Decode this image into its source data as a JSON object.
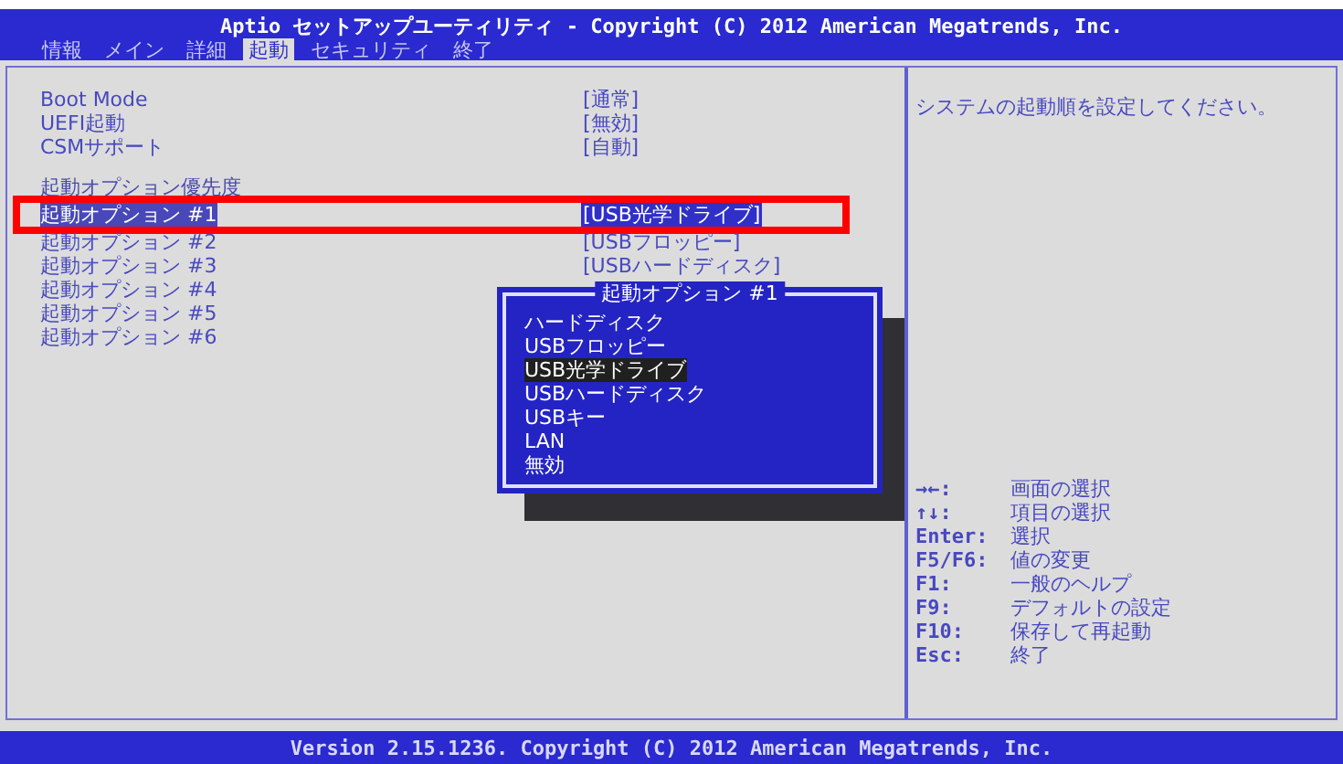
{
  "title": "Aptio セットアップユーティリティ - Copyright (C) 2012 American Megatrends, Inc.",
  "tabs": [
    {
      "label": "情報",
      "selected": false
    },
    {
      "label": "メイン",
      "selected": false
    },
    {
      "label": "詳細",
      "selected": false
    },
    {
      "label": "起動",
      "selected": true
    },
    {
      "label": "セキュリティ",
      "selected": false
    },
    {
      "label": "終了",
      "selected": false
    }
  ],
  "settings": [
    {
      "kind": "setting",
      "label": "Boot Mode",
      "value": "[通常]",
      "selected": false
    },
    {
      "kind": "setting",
      "label": "UEFI起動",
      "value": "[無効]",
      "selected": false
    },
    {
      "kind": "setting",
      "label": "CSMサポート",
      "value": "[自動]",
      "selected": false
    },
    {
      "kind": "spacer"
    },
    {
      "kind": "heading",
      "label": "起動オプション優先度"
    },
    {
      "kind": "setting",
      "label": "起動オプション #1",
      "value": "[USB光学ドライブ]",
      "selected": true,
      "highlighted": true
    },
    {
      "kind": "setting",
      "label": "起動オプション #2",
      "value": "[USBフロッピー]",
      "selected": false
    },
    {
      "kind": "setting",
      "label": "起動オプション #3",
      "value": "[USBハードディスク]",
      "selected": false
    },
    {
      "kind": "setting",
      "label": "起動オプション #4",
      "selected": false
    },
    {
      "kind": "setting",
      "label": "起動オプション #5",
      "selected": false
    },
    {
      "kind": "setting",
      "label": "起動オプション #6",
      "selected": false
    }
  ],
  "popup": {
    "title": "起動オプション #1",
    "options": [
      {
        "label": "ハードディスク",
        "selected": false
      },
      {
        "label": "USBフロッピー",
        "selected": false
      },
      {
        "label": "USB光学ドライブ",
        "selected": true
      },
      {
        "label": "USBハードディスク",
        "selected": false
      },
      {
        "label": "USBキー",
        "selected": false
      },
      {
        "label": "LAN",
        "selected": false
      },
      {
        "label": "無効",
        "selected": false
      }
    ]
  },
  "help_text": "システムの起動順を設定してください。",
  "key_help": [
    {
      "key": "→←:",
      "action": "画面の選択"
    },
    {
      "key": "↑↓:",
      "action": "項目の選択"
    },
    {
      "key": "Enter:",
      "action": "選択"
    },
    {
      "key": "F5/F6:",
      "action": "値の変更"
    },
    {
      "key": "F1:",
      "action": "一般のヘルプ"
    },
    {
      "key": "F9:",
      "action": "デフォルトの設定"
    },
    {
      "key": "F10:",
      "action": "保存して再起動"
    },
    {
      "key": "Esc:",
      "action": "終了"
    }
  ],
  "footer": "Version 2.15.1236. Copyright (C) 2012 American Megatrends, Inc."
}
